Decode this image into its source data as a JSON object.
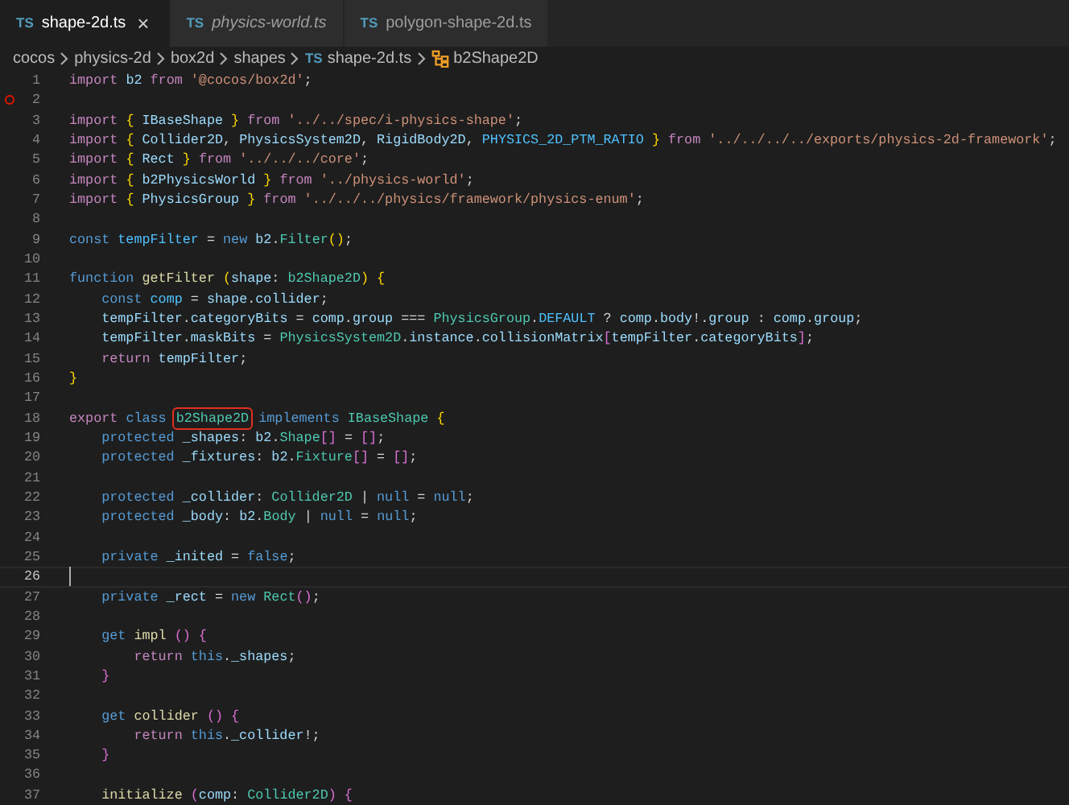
{
  "tabs": [
    {
      "icon": "TS",
      "label": "shape-2d.ts",
      "selected": true,
      "preview": false,
      "close": "×"
    },
    {
      "icon": "TS",
      "label": "physics-world.ts",
      "selected": false,
      "preview": true
    },
    {
      "icon": "TS",
      "label": "polygon-shape-2d.ts",
      "selected": false,
      "preview": false
    }
  ],
  "breadcrumbs": [
    {
      "kind": "folder",
      "text": "cocos"
    },
    {
      "kind": "folder",
      "text": "physics-2d"
    },
    {
      "kind": "folder",
      "text": "box2d"
    },
    {
      "kind": "folder",
      "text": "shapes"
    },
    {
      "kind": "file",
      "icon": "TS",
      "text": "shape-2d.ts"
    },
    {
      "kind": "symbol",
      "text": "b2Shape2D"
    }
  ],
  "lines": [
    {
      "number": "1",
      "breakpoint": false,
      "current": false,
      "segments": [
        {
          "kind": "kw",
          "text": "import "
        },
        {
          "kind": "var",
          "text": "b2 "
        },
        {
          "kind": "kw",
          "text": "from "
        },
        {
          "kind": "str",
          "text": "'@cocos/box2d'"
        },
        {
          "kind": "p",
          "text": ";"
        }
      ]
    },
    {
      "number": "2",
      "breakpoint": true,
      "current": false
    },
    {
      "number": "3",
      "breakpoint": false,
      "current": false,
      "segments": [
        {
          "kind": "kw",
          "text": "import "
        },
        {
          "kind": "b1",
          "text": "{ "
        },
        {
          "kind": "var",
          "text": "IBaseShape "
        },
        {
          "kind": "b1",
          "text": "} "
        },
        {
          "kind": "kw",
          "text": "from "
        },
        {
          "kind": "str",
          "text": "'../../spec/i-physics-shape'"
        },
        {
          "kind": "p",
          "text": ";"
        }
      ]
    },
    {
      "number": "4",
      "breakpoint": false,
      "current": false,
      "segments": [
        {
          "kind": "kw",
          "text": "import "
        },
        {
          "kind": "b1",
          "text": "{ "
        },
        {
          "kind": "var",
          "text": "Collider2D"
        },
        {
          "kind": "p",
          "text": ", "
        },
        {
          "kind": "var",
          "text": "PhysicsSystem2D"
        },
        {
          "kind": "p",
          "text": ", "
        },
        {
          "kind": "var",
          "text": "RigidBody2D"
        },
        {
          "kind": "p",
          "text": ", "
        },
        {
          "kind": "con",
          "text": "PHYSICS_2D_PTM_RATIO "
        },
        {
          "kind": "b1",
          "text": "} "
        },
        {
          "kind": "kw",
          "text": "from "
        },
        {
          "kind": "str",
          "text": "'../../../../exports/physics-2d-framework'"
        },
        {
          "kind": "p",
          "text": ";"
        }
      ]
    },
    {
      "number": "5",
      "breakpoint": false,
      "current": false,
      "segments": [
        {
          "kind": "kw",
          "text": "import "
        },
        {
          "kind": "b1",
          "text": "{ "
        },
        {
          "kind": "var",
          "text": "Rect "
        },
        {
          "kind": "b1",
          "text": "} "
        },
        {
          "kind": "kw",
          "text": "from "
        },
        {
          "kind": "str",
          "text": "'../../../core'"
        },
        {
          "kind": "p",
          "text": ";"
        }
      ]
    },
    {
      "number": "6",
      "breakpoint": false,
      "current": false,
      "segments": [
        {
          "kind": "kw",
          "text": "import "
        },
        {
          "kind": "b1",
          "text": "{ "
        },
        {
          "kind": "var",
          "text": "b2PhysicsWorld "
        },
        {
          "kind": "b1",
          "text": "} "
        },
        {
          "kind": "kw",
          "text": "from "
        },
        {
          "kind": "str",
          "text": "'../physics-world'"
        },
        {
          "kind": "p",
          "text": ";"
        }
      ]
    },
    {
      "number": "7",
      "breakpoint": false,
      "current": false,
      "segments": [
        {
          "kind": "kw",
          "text": "import "
        },
        {
          "kind": "b1",
          "text": "{ "
        },
        {
          "kind": "var",
          "text": "PhysicsGroup "
        },
        {
          "kind": "b1",
          "text": "} "
        },
        {
          "kind": "kw",
          "text": "from "
        },
        {
          "kind": "str",
          "text": "'../../../physics/framework/physics-enum'"
        },
        {
          "kind": "p",
          "text": ";"
        }
      ]
    },
    {
      "number": "8",
      "breakpoint": false,
      "current": false
    },
    {
      "number": "9",
      "breakpoint": false,
      "current": false,
      "segments": [
        {
          "kind": "st",
          "text": "const "
        },
        {
          "kind": "con",
          "text": "tempFilter "
        },
        {
          "kind": "p",
          "text": "= "
        },
        {
          "kind": "st",
          "text": "new "
        },
        {
          "kind": "var",
          "text": "b2"
        },
        {
          "kind": "p",
          "text": "."
        },
        {
          "kind": "type",
          "text": "Filter"
        },
        {
          "kind": "b1",
          "text": "()"
        },
        {
          "kind": "p",
          "text": ";"
        }
      ]
    },
    {
      "number": "10",
      "breakpoint": false,
      "current": false
    },
    {
      "number": "11",
      "breakpoint": false,
      "current": false,
      "segments": [
        {
          "kind": "st",
          "text": "function "
        },
        {
          "kind": "fn",
          "text": "getFilter "
        },
        {
          "kind": "b1",
          "text": "("
        },
        {
          "kind": "var",
          "text": "shape"
        },
        {
          "kind": "p",
          "text": ": "
        },
        {
          "kind": "type",
          "text": "b2Shape2D"
        },
        {
          "kind": "b1",
          "text": ") {"
        }
      ]
    },
    {
      "number": "12",
      "breakpoint": false,
      "current": false,
      "segments": [
        {
          "kind": "st",
          "text": "    const "
        },
        {
          "kind": "con",
          "text": "comp "
        },
        {
          "kind": "p",
          "text": "= "
        },
        {
          "kind": "var",
          "text": "shape"
        },
        {
          "kind": "p",
          "text": "."
        },
        {
          "kind": "var",
          "text": "collider"
        },
        {
          "kind": "p",
          "text": ";"
        }
      ]
    },
    {
      "number": "13",
      "breakpoint": false,
      "current": false,
      "segments": [
        {
          "kind": "var",
          "text": "    tempFilter"
        },
        {
          "kind": "p",
          "text": "."
        },
        {
          "kind": "var",
          "text": "categoryBits "
        },
        {
          "kind": "p",
          "text": "= "
        },
        {
          "kind": "var",
          "text": "comp"
        },
        {
          "kind": "p",
          "text": "."
        },
        {
          "kind": "var",
          "text": "group "
        },
        {
          "kind": "p",
          "text": "=== "
        },
        {
          "kind": "type",
          "text": "PhysicsGroup"
        },
        {
          "kind": "p",
          "text": "."
        },
        {
          "kind": "con",
          "text": "DEFAULT "
        },
        {
          "kind": "p",
          "text": "? "
        },
        {
          "kind": "var",
          "text": "comp"
        },
        {
          "kind": "p",
          "text": "."
        },
        {
          "kind": "var",
          "text": "body"
        },
        {
          "kind": "p",
          "text": "!."
        },
        {
          "kind": "var",
          "text": "group "
        },
        {
          "kind": "p",
          "text": ": "
        },
        {
          "kind": "var",
          "text": "comp"
        },
        {
          "kind": "p",
          "text": "."
        },
        {
          "kind": "var",
          "text": "group"
        },
        {
          "kind": "p",
          "text": ";"
        }
      ]
    },
    {
      "number": "14",
      "breakpoint": false,
      "current": false,
      "segments": [
        {
          "kind": "var",
          "text": "    tempFilter"
        },
        {
          "kind": "p",
          "text": "."
        },
        {
          "kind": "var",
          "text": "maskBits "
        },
        {
          "kind": "p",
          "text": "= "
        },
        {
          "kind": "type",
          "text": "PhysicsSystem2D"
        },
        {
          "kind": "p",
          "text": "."
        },
        {
          "kind": "var",
          "text": "instance"
        },
        {
          "kind": "p",
          "text": "."
        },
        {
          "kind": "var",
          "text": "collisionMatrix"
        },
        {
          "kind": "b2",
          "text": "["
        },
        {
          "kind": "var",
          "text": "tempFilter"
        },
        {
          "kind": "p",
          "text": "."
        },
        {
          "kind": "var",
          "text": "categoryBits"
        },
        {
          "kind": "b2",
          "text": "]"
        },
        {
          "kind": "p",
          "text": ";"
        }
      ]
    },
    {
      "number": "15",
      "breakpoint": false,
      "current": false,
      "segments": [
        {
          "kind": "kw",
          "text": "    return "
        },
        {
          "kind": "var",
          "text": "tempFilter"
        },
        {
          "kind": "p",
          "text": ";"
        }
      ]
    },
    {
      "number": "16",
      "breakpoint": false,
      "current": false,
      "segments": [
        {
          "kind": "b1",
          "text": "}"
        }
      ]
    },
    {
      "number": "17",
      "breakpoint": false,
      "current": false
    },
    {
      "number": "18",
      "breakpoint": false,
      "current": false,
      "segments": [
        {
          "kind": "kw",
          "text": "export "
        },
        {
          "kind": "st",
          "text": "class "
        },
        {
          "kind": "mark",
          "text": "b2Shape2D"
        },
        {
          "kind": "st",
          "text": " implements "
        },
        {
          "kind": "type",
          "text": "IBaseShape "
        },
        {
          "kind": "b1",
          "text": "{"
        }
      ]
    },
    {
      "number": "19",
      "breakpoint": false,
      "current": false,
      "segments": [
        {
          "kind": "st",
          "text": "    protected "
        },
        {
          "kind": "var",
          "text": "_shapes"
        },
        {
          "kind": "p",
          "text": ": "
        },
        {
          "kind": "var",
          "text": "b2"
        },
        {
          "kind": "p",
          "text": "."
        },
        {
          "kind": "type",
          "text": "Shape"
        },
        {
          "kind": "b2",
          "text": "[]"
        },
        {
          "kind": "p",
          "text": " = "
        },
        {
          "kind": "b2",
          "text": "[]"
        },
        {
          "kind": "p",
          "text": ";"
        }
      ]
    },
    {
      "number": "20",
      "breakpoint": false,
      "current": false,
      "segments": [
        {
          "kind": "st",
          "text": "    protected "
        },
        {
          "kind": "var",
          "text": "_fixtures"
        },
        {
          "kind": "p",
          "text": ": "
        },
        {
          "kind": "var",
          "text": "b2"
        },
        {
          "kind": "p",
          "text": "."
        },
        {
          "kind": "type",
          "text": "Fixture"
        },
        {
          "kind": "b2",
          "text": "[]"
        },
        {
          "kind": "p",
          "text": " = "
        },
        {
          "kind": "b2",
          "text": "[]"
        },
        {
          "kind": "p",
          "text": ";"
        }
      ]
    },
    {
      "number": "21",
      "breakpoint": false,
      "current": false
    },
    {
      "number": "22",
      "breakpoint": false,
      "current": false,
      "segments": [
        {
          "kind": "st",
          "text": "    protected "
        },
        {
          "kind": "var",
          "text": "_collider"
        },
        {
          "kind": "p",
          "text": ": "
        },
        {
          "kind": "type",
          "text": "Collider2D "
        },
        {
          "kind": "p",
          "text": "| "
        },
        {
          "kind": "st",
          "text": "null "
        },
        {
          "kind": "p",
          "text": "= "
        },
        {
          "kind": "st",
          "text": "null"
        },
        {
          "kind": "p",
          "text": ";"
        }
      ]
    },
    {
      "number": "23",
      "breakpoint": false,
      "current": false,
      "segments": [
        {
          "kind": "st",
          "text": "    protected "
        },
        {
          "kind": "var",
          "text": "_body"
        },
        {
          "kind": "p",
          "text": ": "
        },
        {
          "kind": "var",
          "text": "b2"
        },
        {
          "kind": "p",
          "text": "."
        },
        {
          "kind": "type",
          "text": "Body "
        },
        {
          "kind": "p",
          "text": "| "
        },
        {
          "kind": "st",
          "text": "null "
        },
        {
          "kind": "p",
          "text": "= "
        },
        {
          "kind": "st",
          "text": "null"
        },
        {
          "kind": "p",
          "text": ";"
        }
      ]
    },
    {
      "number": "24",
      "breakpoint": false,
      "current": false
    },
    {
      "number": "25",
      "breakpoint": false,
      "current": false,
      "segments": [
        {
          "kind": "st",
          "text": "    private "
        },
        {
          "kind": "var",
          "text": "_inited "
        },
        {
          "kind": "p",
          "text": "= "
        },
        {
          "kind": "st",
          "text": "false"
        },
        {
          "kind": "p",
          "text": ";"
        }
      ]
    },
    {
      "number": "26",
      "breakpoint": false,
      "current": true
    },
    {
      "number": "27",
      "breakpoint": false,
      "current": false,
      "segments": [
        {
          "kind": "st",
          "text": "    private "
        },
        {
          "kind": "var",
          "text": "_rect "
        },
        {
          "kind": "p",
          "text": "= "
        },
        {
          "kind": "st",
          "text": "new "
        },
        {
          "kind": "type",
          "text": "Rect"
        },
        {
          "kind": "b2",
          "text": "()"
        },
        {
          "kind": "p",
          "text": ";"
        }
      ]
    },
    {
      "number": "28",
      "breakpoint": false,
      "current": false
    },
    {
      "number": "29",
      "breakpoint": false,
      "current": false,
      "segments": [
        {
          "kind": "st",
          "text": "    get "
        },
        {
          "kind": "fn",
          "text": "impl "
        },
        {
          "kind": "b2",
          "text": "() {"
        }
      ]
    },
    {
      "number": "30",
      "breakpoint": false,
      "current": false,
      "segments": [
        {
          "kind": "kw",
          "text": "        return "
        },
        {
          "kind": "st",
          "text": "this"
        },
        {
          "kind": "p",
          "text": "."
        },
        {
          "kind": "var",
          "text": "_shapes"
        },
        {
          "kind": "p",
          "text": ";"
        }
      ]
    },
    {
      "number": "31",
      "breakpoint": false,
      "current": false,
      "segments": [
        {
          "kind": "b2",
          "text": "    }"
        }
      ]
    },
    {
      "number": "32",
      "breakpoint": false,
      "current": false
    },
    {
      "number": "33",
      "breakpoint": false,
      "current": false,
      "segments": [
        {
          "kind": "st",
          "text": "    get "
        },
        {
          "kind": "fn",
          "text": "collider "
        },
        {
          "kind": "b2",
          "text": "() {"
        }
      ]
    },
    {
      "number": "34",
      "breakpoint": false,
      "current": false,
      "segments": [
        {
          "kind": "kw",
          "text": "        return "
        },
        {
          "kind": "st",
          "text": "this"
        },
        {
          "kind": "p",
          "text": "."
        },
        {
          "kind": "var",
          "text": "_collider"
        },
        {
          "kind": "p",
          "text": "!;"
        }
      ]
    },
    {
      "number": "35",
      "breakpoint": false,
      "current": false,
      "segments": [
        {
          "kind": "b2",
          "text": "    }"
        }
      ]
    },
    {
      "number": "36",
      "breakpoint": false,
      "current": false
    },
    {
      "number": "37",
      "breakpoint": false,
      "current": false,
      "segments": [
        {
          "kind": "fn",
          "text": "    initialize "
        },
        {
          "kind": "b2",
          "text": "("
        },
        {
          "kind": "var",
          "text": "comp"
        },
        {
          "kind": "p",
          "text": ": "
        },
        {
          "kind": "type",
          "text": "Collider2D"
        },
        {
          "kind": "b2",
          "text": ") {"
        }
      ]
    }
  ]
}
